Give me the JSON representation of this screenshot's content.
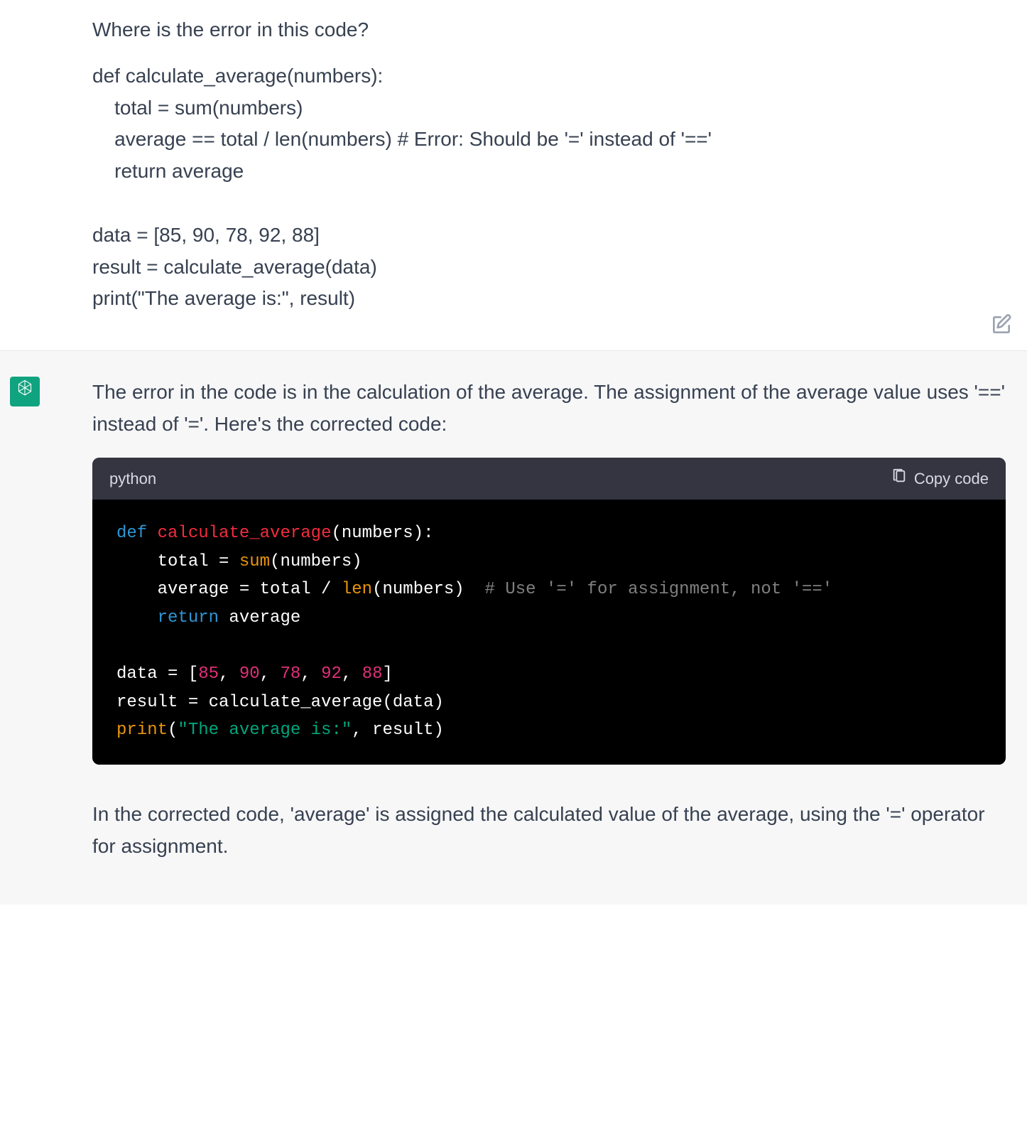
{
  "user": {
    "question": "Where is the error in this code?",
    "code_line1": "def calculate_average(numbers):",
    "code_line2": "    total = sum(numbers)",
    "code_line3": "    average == total / len(numbers) # Error: Should be '=' instead of '=='",
    "code_line4": "    return average",
    "code_line5": "data = [85, 90, 78, 92, 88]",
    "code_line6": "result = calculate_average(data)",
    "code_line7": "print(\"The average is:\", result)"
  },
  "assistant": {
    "intro": "The error in the code is in the calculation of the average. The assignment of the average value uses '==' instead of '='. Here's the corrected code:",
    "outro": "In the corrected code, 'average' is assigned the calculated value of the average, using the '=' operator for assignment."
  },
  "code": {
    "language": "python",
    "copy_label": "Copy code",
    "kw_def": "def",
    "fn_name": "calculate_average",
    "sig_after": "(numbers):",
    "line2_a": "    total = ",
    "bi_sum": "sum",
    "line2_b": "(numbers)",
    "line3_a": "    average = total / ",
    "bi_len": "len",
    "line3_b": "(numbers)  ",
    "comment3": "# Use '=' for assignment, not '=='",
    "kw_return": "return",
    "line4_rest": " average",
    "line5_a": "data = [",
    "n1": "85",
    "c1": ", ",
    "n2": "90",
    "c2": ", ",
    "n3": "78",
    "c3": ", ",
    "n4": "92",
    "c4": ", ",
    "n5": "88",
    "line5_z": "]",
    "line6": "result = calculate_average(data)",
    "bi_print": "print",
    "line7_a": "(",
    "str7": "\"The average is:\"",
    "line7_b": ", result)",
    "indent4": "    "
  }
}
